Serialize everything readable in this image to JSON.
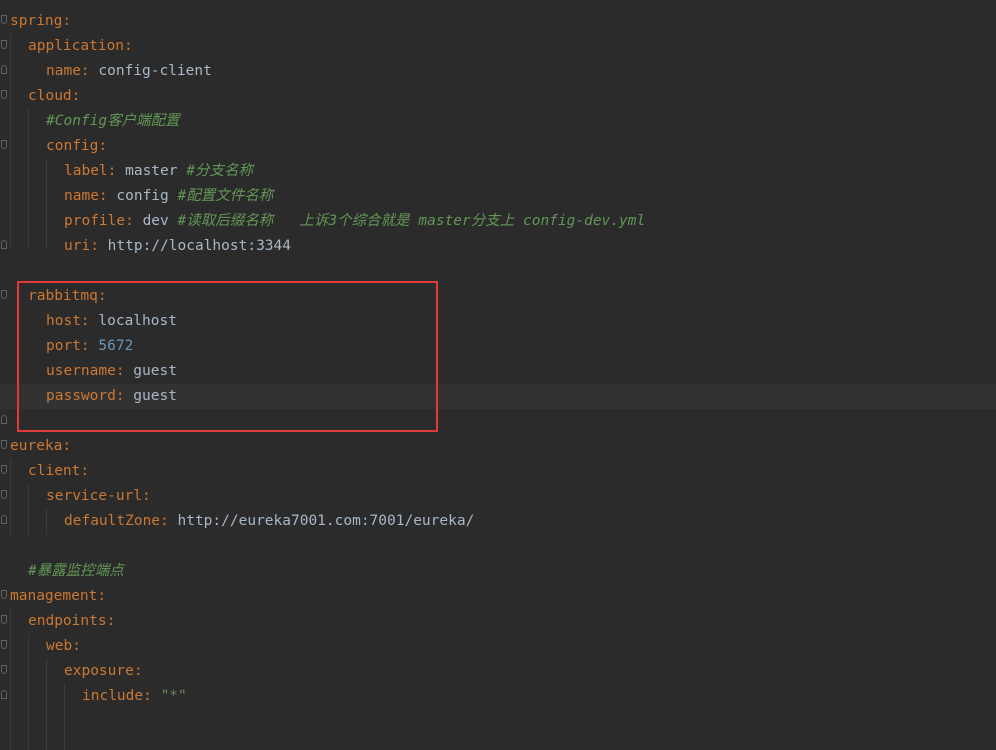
{
  "editor": {
    "highlight_color": "#e03a3a",
    "lines": [
      {
        "key": "spring",
        "colon": ":",
        "value": "",
        "comment": ""
      },
      {
        "key": "application",
        "colon": ":",
        "value": "",
        "comment": ""
      },
      {
        "key": "name",
        "colon": ":",
        "value": " config-client",
        "comment": ""
      },
      {
        "key": "cloud",
        "colon": ":",
        "value": "",
        "comment": ""
      },
      {
        "key": "",
        "colon": "",
        "value": "",
        "comment": "#Config客户端配置"
      },
      {
        "key": "config",
        "colon": ":",
        "value": "",
        "comment": ""
      },
      {
        "key": "label",
        "colon": ":",
        "value": " master ",
        "comment": "#分支名称"
      },
      {
        "key": "name",
        "colon": ":",
        "value": " config ",
        "comment": "#配置文件名称"
      },
      {
        "key": "profile",
        "colon": ":",
        "value": " dev ",
        "comment": "#读取后缀名称   上诉3个综合就是 master分支上 config-dev.yml"
      },
      {
        "key": "uri",
        "colon": ":",
        "value": " http://localhost:3344",
        "comment": ""
      },
      {
        "key": "",
        "colon": "",
        "value": "",
        "comment": ""
      },
      {
        "key": "rabbitmq",
        "colon": ":",
        "value": "",
        "comment": ""
      },
      {
        "key": "host",
        "colon": ":",
        "value": " localhost",
        "comment": ""
      },
      {
        "key": "port",
        "colon": ":",
        "value": " 5672",
        "comment": ""
      },
      {
        "key": "username",
        "colon": ":",
        "value": " guest",
        "comment": ""
      },
      {
        "key": "password",
        "colon": ":",
        "value": " guest",
        "comment": ""
      },
      {
        "key": "",
        "colon": "",
        "value": "",
        "comment": ""
      },
      {
        "key": "eureka",
        "colon": ":",
        "value": "",
        "comment": ""
      },
      {
        "key": "client",
        "colon": ":",
        "value": "",
        "comment": ""
      },
      {
        "key": "service-url",
        "colon": ":",
        "value": "",
        "comment": ""
      },
      {
        "key": "defaultZone",
        "colon": ":",
        "value": " http://eureka7001.com:7001/eureka/",
        "comment": ""
      },
      {
        "key": "",
        "colon": "",
        "value": "",
        "comment": ""
      },
      {
        "key": "",
        "colon": "",
        "value": "",
        "comment": "#暴露监控端点"
      },
      {
        "key": "management",
        "colon": ":",
        "value": "",
        "comment": ""
      },
      {
        "key": "endpoints",
        "colon": ":",
        "value": "",
        "comment": ""
      },
      {
        "key": "web",
        "colon": ":",
        "value": "",
        "comment": ""
      },
      {
        "key": "exposure",
        "colon": ":",
        "value": "",
        "comment": ""
      },
      {
        "key": "include",
        "colon": ":",
        "value": " \"*\"",
        "comment": ""
      }
    ]
  }
}
